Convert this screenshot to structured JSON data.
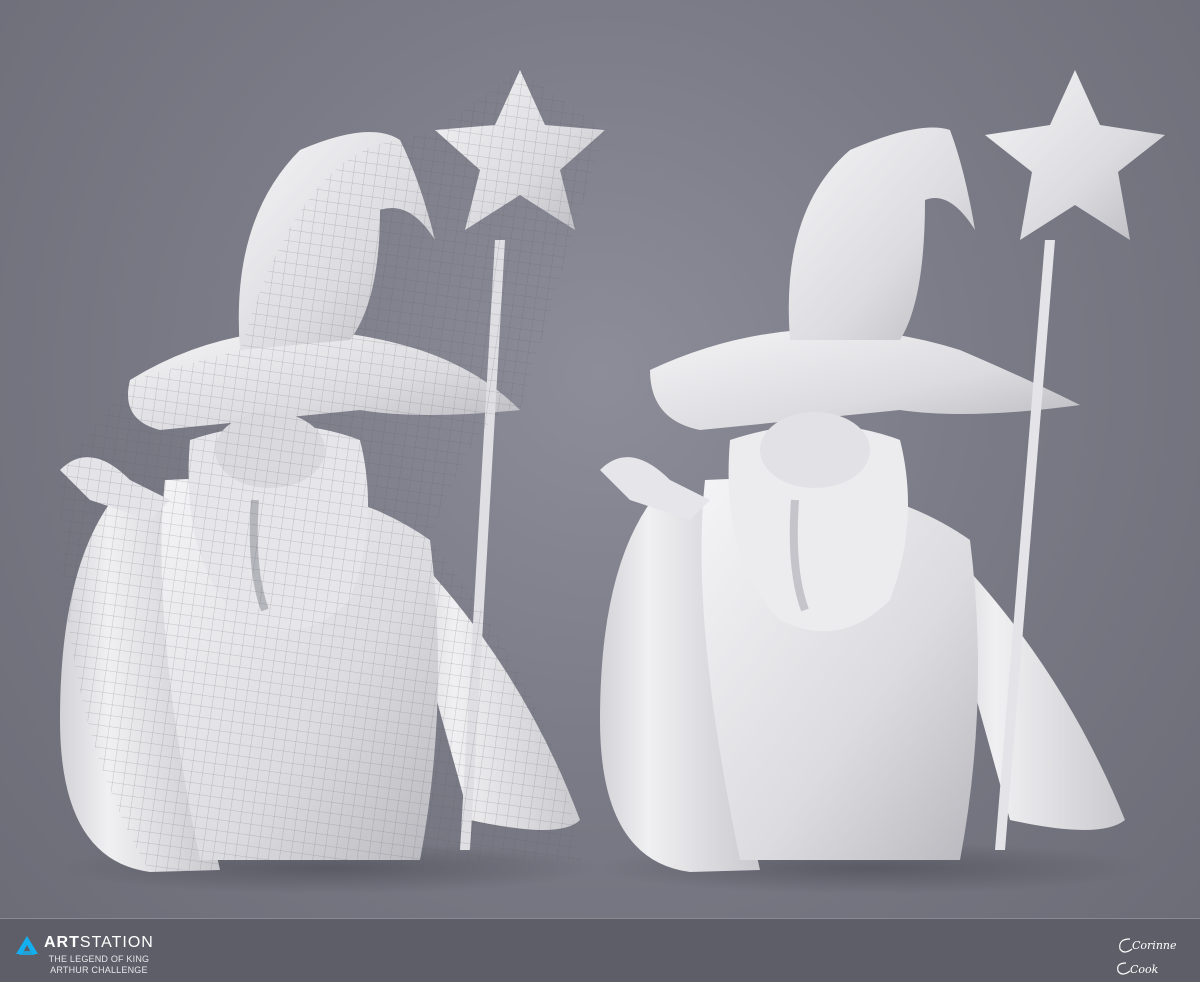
{
  "image": {
    "description_labels": [
      "wireframe-render",
      "clay-render"
    ]
  },
  "footer": {
    "brand_name_bold": "ART",
    "brand_name_rest": "STATION",
    "brand_subtitle_line1": "THE LEGEND OF KING",
    "brand_subtitle_line2": "ARTHUR CHALLENGE",
    "signature_line1": "Corinne",
    "signature_line2": "Cook",
    "brand_color": "#13aff0"
  },
  "colors": {
    "background": "#7b7b87",
    "footer": "#5e5e68",
    "clay": "#e9e9ec"
  }
}
